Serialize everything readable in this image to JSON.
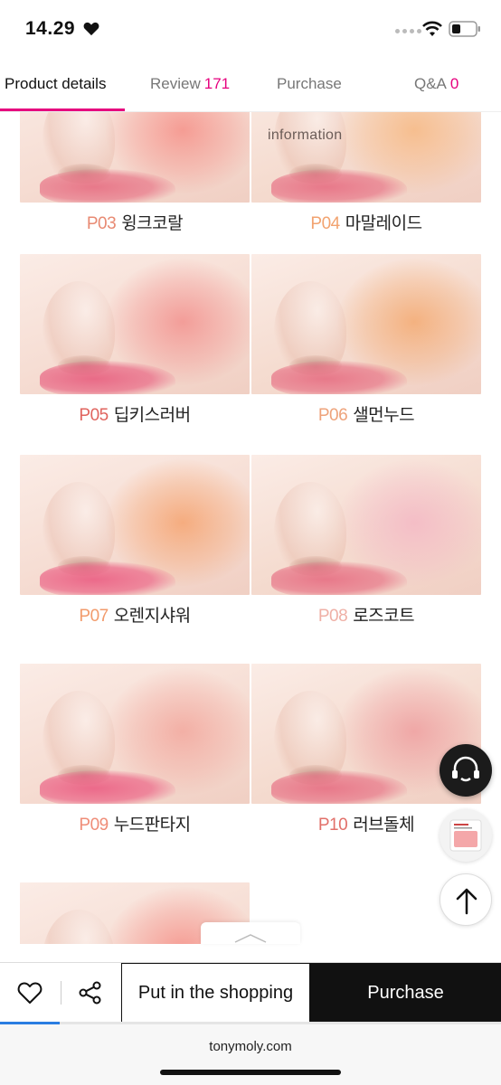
{
  "status": {
    "time": "14.29",
    "colors": {
      "heart": "#111111",
      "signal_dot": "#bbbbbb"
    }
  },
  "tabs": [
    {
      "label": "Product details",
      "count": "",
      "active": true
    },
    {
      "label": "Review",
      "count": "171",
      "active": false
    },
    {
      "label": "Purchase",
      "count": "",
      "active": false
    },
    {
      "label": "Q&A",
      "count": "0",
      "active": false
    }
  ],
  "accent_color": "#e6007e",
  "overlay_text": "information",
  "swatches": [
    {
      "code": "P03",
      "name": "윙크코랄",
      "code_color": "#e88a73",
      "blush": "#f58c84",
      "lip": "#e8798a"
    },
    {
      "code": "P04",
      "name": "마말레이드",
      "code_color": "#f2a370",
      "blush": "#f7b77f",
      "lip": "#e8798a"
    },
    {
      "code": "P05",
      "name": "딥키스러버",
      "code_color": "#e0645e",
      "blush": "#f28d8a",
      "lip": "#e96b87"
    },
    {
      "code": "P06",
      "name": "샐먼누드",
      "code_color": "#eea37b",
      "blush": "#f3a76c",
      "lip": "#e8798a"
    },
    {
      "code": "P07",
      "name": "오렌지샤워",
      "code_color": "#f29b6c",
      "blush": "#f5a06a",
      "lip": "#ec6a8a"
    },
    {
      "code": "P08",
      "name": "로즈코트",
      "code_color": "#efb0a6",
      "blush": "#f4b6c4",
      "lip": "#e8798a"
    },
    {
      "code": "P09",
      "name": "누드판타지",
      "code_color": "#ef8d78",
      "blush": "#f2a49a",
      "lip": "#ec6a8a"
    },
    {
      "code": "P10",
      "name": "러브돌체",
      "code_color": "#e2706a",
      "blush": "#ee9a9c",
      "lip": "#e8798a"
    }
  ],
  "action_bar": {
    "wishlist_icon": "heart-outline-icon",
    "share_icon": "share-icon",
    "cart_label": "Put in the shopping",
    "purchase_label": "Purchase"
  },
  "floating": {
    "chat_icon": "headset-chat-icon",
    "product_icon": "product-thumbnail",
    "top_icon": "arrow-up-icon"
  },
  "browser": {
    "url": "tonymoly.com"
  }
}
